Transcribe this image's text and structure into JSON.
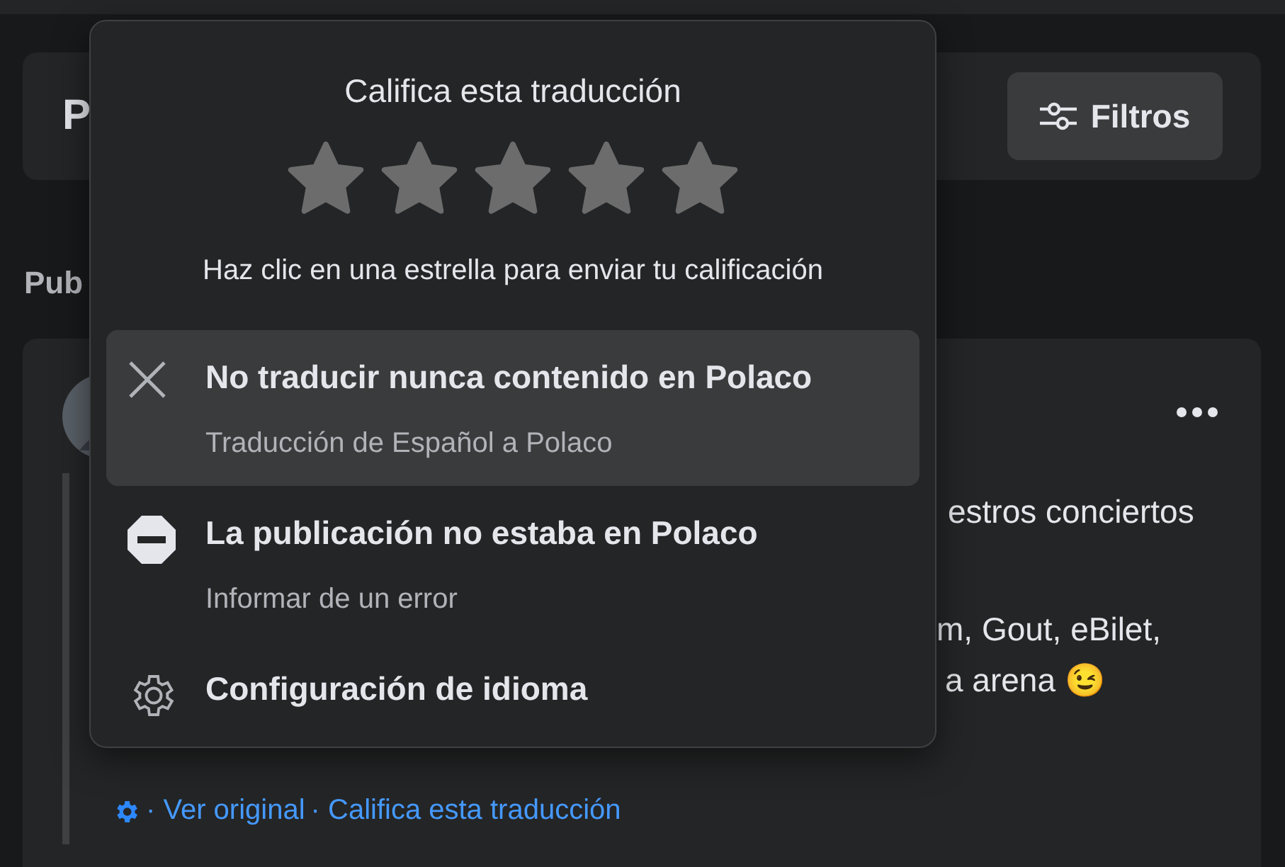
{
  "header": {
    "title": "P",
    "filter_button": "Filtros"
  },
  "section_heading": "Pub",
  "post": {
    "lines": [
      "estros conciertos",
      "m, Gout, eBilet,",
      "a arena 😉"
    ],
    "footer_links": [
      "· Ver original",
      "· Califica esta traducción"
    ]
  },
  "rating_popup": {
    "title": "Califica esta traducción",
    "stars": 0,
    "hint": "Haz clic en una estrella para enviar tu calificación",
    "items": [
      {
        "kind": "close",
        "title": "No traducir nunca contenido en Polaco",
        "subtitle": "Traducción de Español a Polaco",
        "selected": true
      },
      {
        "kind": "block",
        "title": "La publicación no estaba en Polaco",
        "subtitle": "Informar de un error",
        "selected": false
      },
      {
        "kind": "settings",
        "title": "Configuración de idioma",
        "selected": false
      }
    ]
  }
}
